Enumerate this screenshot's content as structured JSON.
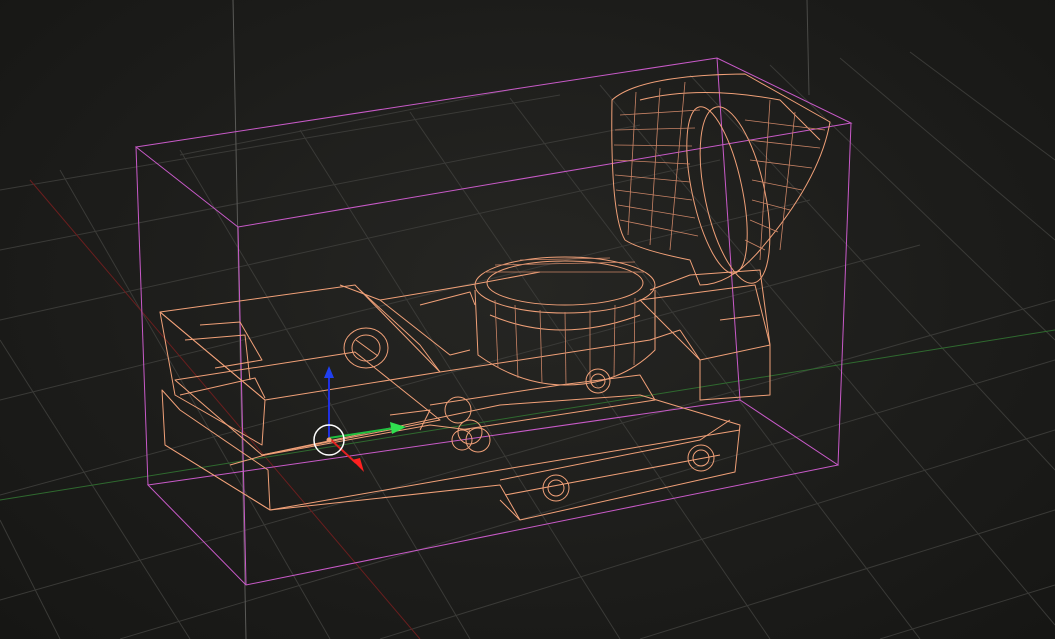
{
  "viewport": {
    "view": "perspective",
    "shading": "wireframe",
    "grid": true,
    "colors": {
      "background": "#1c1c1a",
      "grid": "#3a3a37",
      "x_axis": "#7a2020",
      "y_axis": "#2f6a2f",
      "z_axis": "#555553",
      "wireframe": "#f0a078",
      "bounding_box": "#c85ac8",
      "gizmo_x": "#e02020",
      "gizmo_y": "#20c040",
      "gizmo_z": "#2030e0",
      "gizmo_center": "#ffffff"
    }
  },
  "object": {
    "icon": "red-dot-sight-mesh",
    "selected": true
  },
  "gizmo": {
    "icon": "transform-gizmo"
  }
}
